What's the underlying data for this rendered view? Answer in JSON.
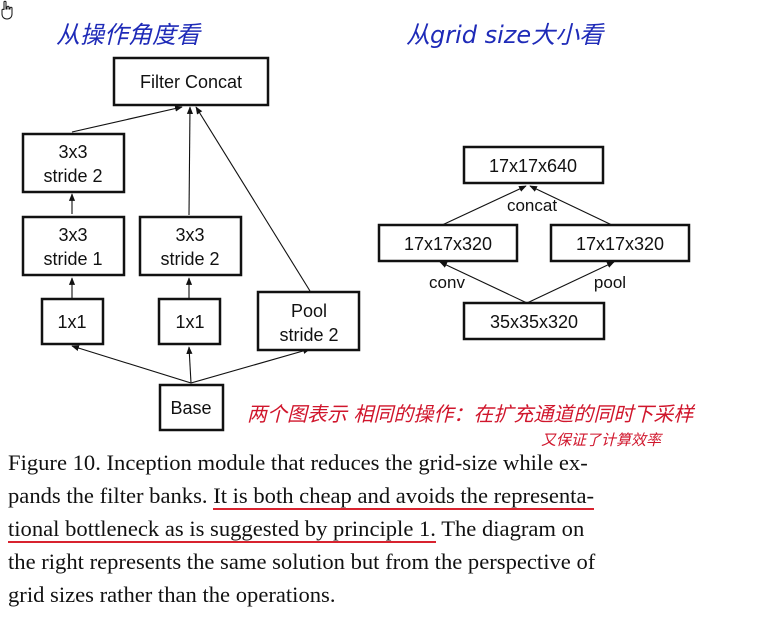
{
  "annotations": {
    "left_title": "从操作角度看",
    "right_title": "从grid size大小看",
    "note_line1": "两个图表示 相同的操作：在扩充通道的同时下采样",
    "note_line2": "又保证了计算效率"
  },
  "left_diagram": {
    "filter_concat": "Filter Concat",
    "conv3x3_s2_top_l1": "3x3",
    "conv3x3_s2_top_l2": "stride 2",
    "conv3x3_s1_l1": "3x3",
    "conv3x3_s1_l2": "stride 1",
    "conv3x3_s2_mid_l1": "3x3",
    "conv3x3_s2_mid_l2": "stride 2",
    "conv1x1_left": "1x1",
    "conv1x1_mid": "1x1",
    "pool_l1": "Pool",
    "pool_l2": "stride 2",
    "base": "Base"
  },
  "right_diagram": {
    "top": "17x17x640",
    "concat_label": "concat",
    "left_mid": "17x17x320",
    "right_mid": "17x17x320",
    "conv_label": "conv",
    "pool_label": "pool",
    "bottom": "35x35x320"
  },
  "caption": {
    "line1": "Figure 10. Inception module that reduces the grid-size while ex-",
    "line2_a": "pands the filter banks. ",
    "line2_b": "It is both cheap and avoids the representa-",
    "line3_a": "tional bottleneck as is ",
    "line3_b": "suggested by principle 1.",
    "line3_c": " The diagram on",
    "line4": "the right represents the same solution but from the perspective of",
    "line5": "grid sizes rather than the operations."
  },
  "colors": {
    "blue_ink": "#1f2bb8",
    "red_ink": "#d0162c",
    "text": "#111111"
  }
}
